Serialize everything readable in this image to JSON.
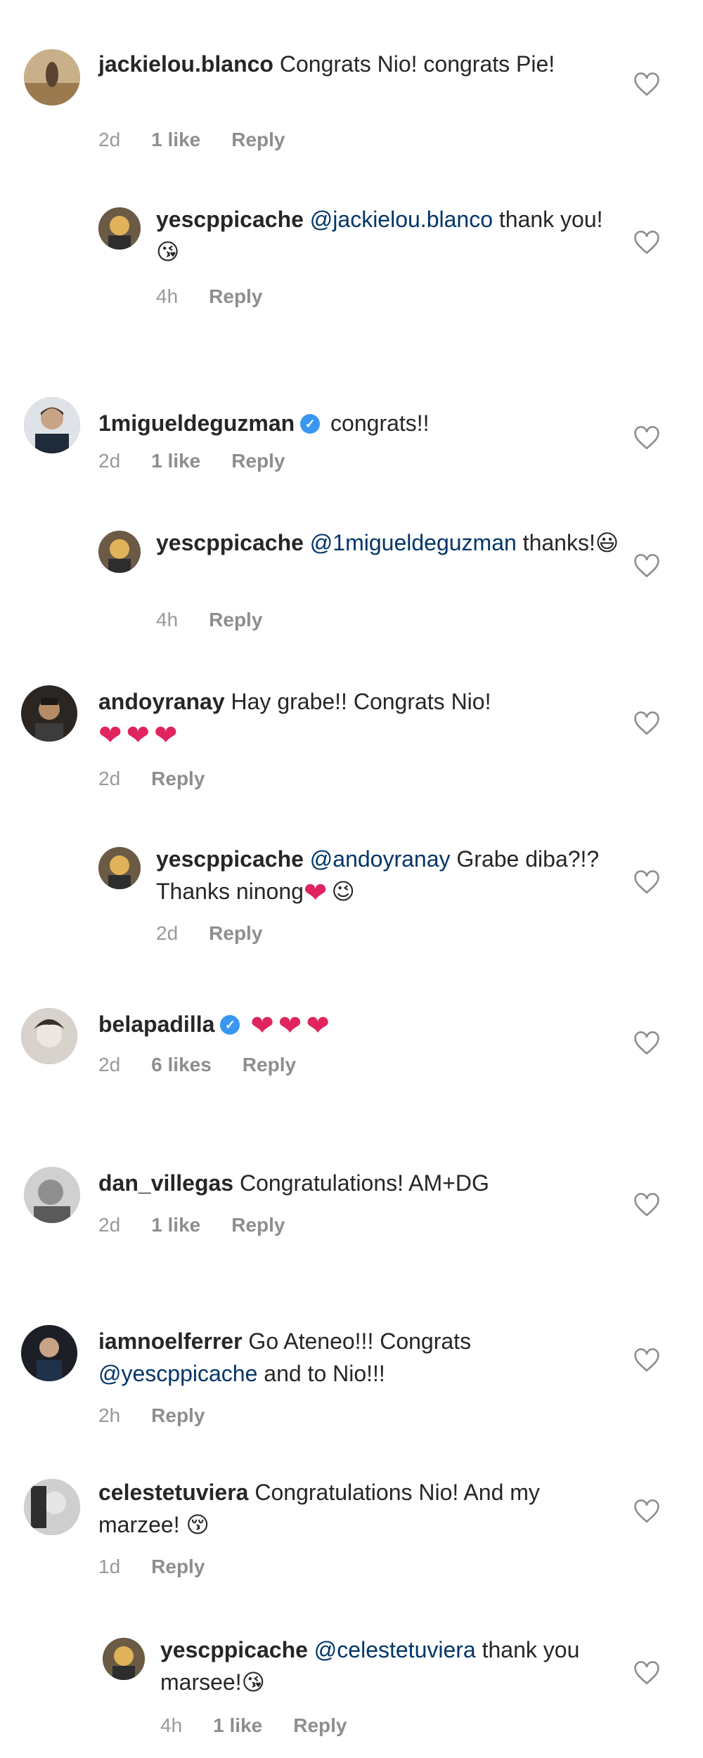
{
  "comments": [
    {
      "username": "jackielou.blanco",
      "text": " Congrats Nio! congrats Pie!",
      "time": "2d",
      "likes": "1 like",
      "reply": "Reply"
    },
    {
      "username": "yescppicache",
      "mention": "@jackielou.blanco",
      "text": " thank you!",
      "emoji": "😘",
      "time": "4h",
      "reply": "Reply"
    },
    {
      "username": "1migueldeguzman",
      "text": " congrats!!",
      "time": "2d",
      "likes": "1 like",
      "reply": "Reply"
    },
    {
      "username": "yescppicache",
      "mention": "@1migueldeguzman",
      "text": " thanks!",
      "emoji": "😃",
      "time": "4h",
      "reply": "Reply"
    },
    {
      "username": "andoyranay",
      "text": " Hay grabe!! Congrats Nio!",
      "hearts": "❤❤❤",
      "time": "2d",
      "reply": "Reply"
    },
    {
      "username": "yescppicache",
      "mention": "@andoyranay",
      "text": " Grabe diba?!? Thanks ninong",
      "hearts": "❤",
      "emoji": "😉",
      "time": "2d",
      "reply": "Reply"
    },
    {
      "username": "belapadilla",
      "hearts": "❤❤❤",
      "time": "2d",
      "likes": "6 likes",
      "reply": "Reply"
    },
    {
      "username": "dan_villegas",
      "text": " Congratulations! AM+DG",
      "time": "2d",
      "likes": "1 like",
      "reply": "Reply"
    },
    {
      "username": "iamnoelferrer",
      "text": " Go Ateneo!!! Congrats ",
      "mention": "@yescppicache",
      "text2": " and to Nio!!!",
      "time": "2h",
      "reply": "Reply"
    },
    {
      "username": "celestetuviera",
      "text": " Congratulations Nio! And my marzee!",
      "emoji": "😚",
      "time": "1d",
      "reply": "Reply"
    },
    {
      "username": "yescppicache",
      "mention": "@celestetuviera",
      "text": " thank you marsee!",
      "emoji": "😘",
      "time": "4h",
      "likes": "1 like",
      "reply": "Reply"
    }
  ],
  "colors": {
    "mention": "#003569",
    "meta": "#999999",
    "heart": "#e0245e",
    "verified": "#3897f0"
  },
  "icons": {
    "like": "heart-outline-icon",
    "verified": "verified-badge-icon"
  }
}
